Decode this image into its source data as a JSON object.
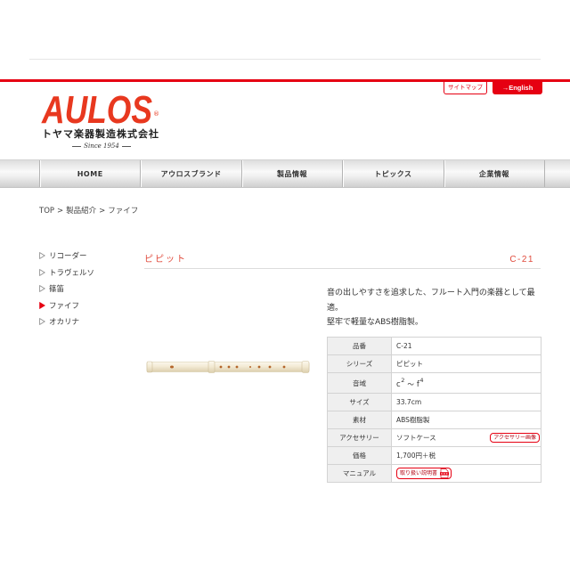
{
  "colors": {
    "accent": "#e60012",
    "logo": "#e8381f",
    "title": "#e04a3c"
  },
  "header": {
    "logo_text": "AULOS",
    "logo_mark": "®",
    "company_name": "トヤマ楽器製造株式会社",
    "since": "Since 1954",
    "sitemap_label": "サイトマップ",
    "english_label": "→English"
  },
  "nav": {
    "items": [
      "HOME",
      "アウロスブランド",
      "製品情報",
      "トピックス",
      "企業情報"
    ]
  },
  "breadcrumb": {
    "items": [
      "TOP",
      "製品紹介",
      "ファイフ"
    ],
    "separator": ">"
  },
  "sidebar": {
    "bullet_icon": "triangle-icon",
    "items": [
      {
        "label": "リコーダー",
        "active": false
      },
      {
        "label": "トラヴェルソ",
        "active": false
      },
      {
        "label": "篠笛",
        "active": false
      },
      {
        "label": "ファイフ",
        "active": true
      },
      {
        "label": "オカリナ",
        "active": false
      }
    ]
  },
  "product": {
    "name": "ピピット",
    "code": "C-21",
    "image_icon": "fife-image",
    "description": [
      "音の出しやすさを追求した、フルート入門の楽器として最適。",
      "堅牢で軽量なABS樹脂製。"
    ],
    "specs": [
      {
        "label": "品番",
        "value": "C-21"
      },
      {
        "label": "シリーズ",
        "value": "ピピット"
      },
      {
        "label": "音域",
        "range": {
          "low": "c",
          "low_octave": "2",
          "sep": "～",
          "high": "f",
          "high_octave": "4"
        }
      },
      {
        "label": "サイズ",
        "value": "33.7cm"
      },
      {
        "label": "素材",
        "value": "ABS樹脂製"
      },
      {
        "label": "アクセサリー",
        "value": "ソフトケース",
        "button": "アクセサリー画像"
      },
      {
        "label": "価格",
        "value": "1,700円＋税"
      },
      {
        "label": "マニュアル",
        "button": "取り扱い説明書",
        "icon": "pdf-icon"
      }
    ]
  }
}
